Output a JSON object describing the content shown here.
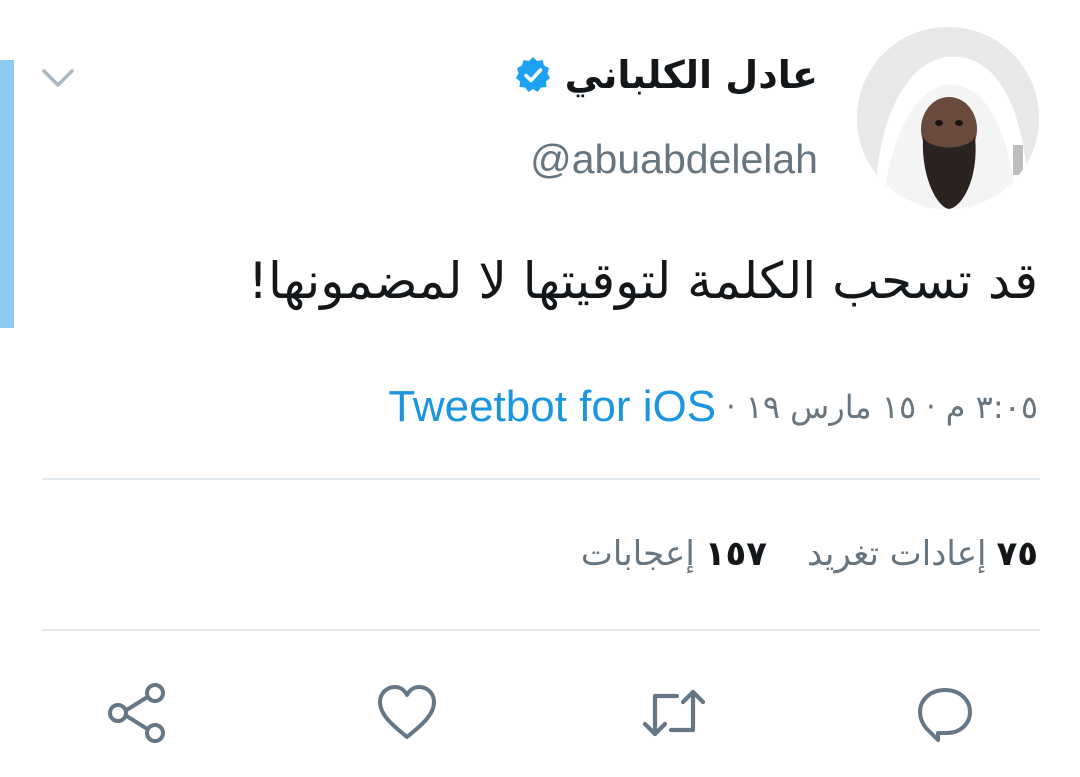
{
  "tweet": {
    "author": {
      "display_name": "عادل الكلباني",
      "handle": "@abuabdelelah",
      "verified": true
    },
    "text": "قد تسحب الكلمة لتوقيتها لا لمضمونها!",
    "meta": {
      "time": "٣:٠٥ م",
      "date": "١٥ مارس ١٩",
      "separator": "·",
      "source": "Tweetbot for iOS"
    },
    "stats": {
      "retweets_count": "٧٥",
      "retweets_label": "إعادات تغريد",
      "likes_count": "١٥٧",
      "likes_label": "إعجابات"
    }
  },
  "icons": {
    "caret": "chevron-down-icon",
    "verified": "verified-badge-icon",
    "reply": "reply-icon",
    "retweet": "retweet-icon",
    "like": "heart-icon",
    "share": "share-icon"
  },
  "colors": {
    "text_primary": "#14171a",
    "text_secondary": "#66757f",
    "link": "#1b95e0",
    "verified": "#1da1f2",
    "icon": "#657786",
    "divider": "#e1e8ed",
    "focus_bar": "#8ecdf2"
  }
}
